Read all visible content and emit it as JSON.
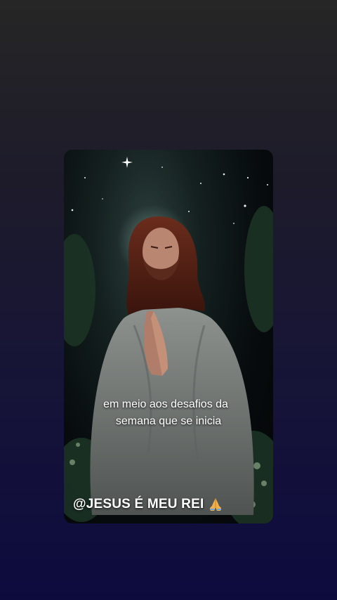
{
  "video": {
    "caption_line1": "em meio aos desafios da",
    "caption_line2": "semana que se inicia",
    "handle": "@JESUS É MEU REI",
    "handle_icon": "praying-hands-icon"
  },
  "colors": {
    "background_top": "#262626",
    "background_bottom": "#0d0b3e",
    "caption_text": "#ffffff"
  }
}
